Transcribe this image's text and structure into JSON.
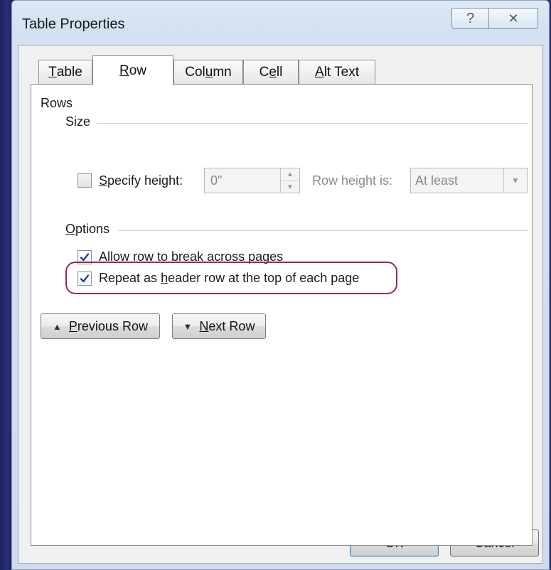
{
  "window": {
    "title": "Table Properties",
    "help_glyph": "?",
    "close_glyph": "✕"
  },
  "tabs": [
    {
      "pre": "",
      "ul": "T",
      "post": "able"
    },
    {
      "pre": "",
      "ul": "R",
      "post": "ow"
    },
    {
      "pre": "Col",
      "ul": "u",
      "post": "mn"
    },
    {
      "pre": "C",
      "ul": "e",
      "post": "ll"
    },
    {
      "pre": "",
      "ul": "A",
      "post": "lt Text"
    }
  ],
  "active_tab": "Row",
  "rows_section": {
    "heading": "Rows",
    "size_heading": "Size",
    "specify_height": {
      "pre": "",
      "ul": "S",
      "post": "pecify height:",
      "checked": false
    },
    "height_value": "0\"",
    "row_height_label": "Row height is:",
    "row_height_value": "At least",
    "options_heading": {
      "pre": "",
      "ul": "O",
      "post": "ptions"
    },
    "allow_break": {
      "pre": "Allow row to brea",
      "ul": "k",
      "post": " across pages",
      "checked": true
    },
    "repeat_header": {
      "pre": "Repeat as ",
      "ul": "h",
      "post": "eader row at the top of each page",
      "checked": true
    }
  },
  "nav_buttons": {
    "previous": {
      "pre": "",
      "ul": "P",
      "post": "revious Row"
    },
    "next": {
      "pre": "",
      "ul": "N",
      "post": "ext Row"
    }
  },
  "footer": {
    "ok": "OK",
    "cancel": "Cancel"
  },
  "colors": {
    "highlight_border": "#9a2a4a",
    "check_mark": "#2b3d9c"
  },
  "icons": {
    "checkmark": "checkmark-icon",
    "spin_up": "spin-up-icon",
    "spin_down": "spin-down-icon",
    "dropdown": "chevron-down-icon",
    "triangle_up": "triangle-up-icon",
    "triangle_down": "triangle-down-icon"
  }
}
